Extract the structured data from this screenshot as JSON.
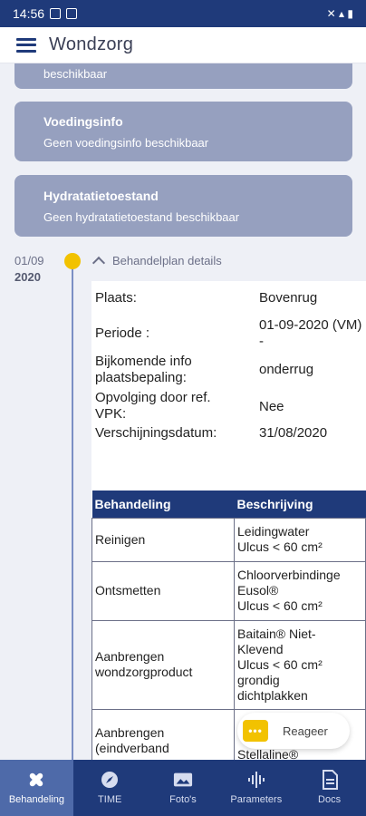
{
  "status": {
    "time": "14:56",
    "right_icons": "✕ ▴ ▮"
  },
  "app": {
    "title": "Wondzorg"
  },
  "cards": [
    {
      "title": "",
      "subtitle": "beschikbaar"
    },
    {
      "title": "Voedingsinfo",
      "subtitle": "Geen voedingsinfo beschikbaar"
    },
    {
      "title": "Hydratatietoestand",
      "subtitle": "Geen hydratatietoestand beschikbaar"
    }
  ],
  "timeline": {
    "date": "01/09",
    "year": "2020",
    "header": "Behandelplan details"
  },
  "details": [
    {
      "label": "Plaats:",
      "value": "Bovenrug"
    },
    {
      "label": "Periode :",
      "value": "01-09-2020 (VM) -"
    },
    {
      "label": "Bijkomende info plaatsbepaling:",
      "value": "onderrug"
    },
    {
      "label": "Opvolging door ref. VPK:",
      "value": "Nee"
    },
    {
      "label": "Verschijningsdatum:",
      "value": "31/08/2020"
    }
  ],
  "table": {
    "headers": [
      "Behandeling",
      "Beschrijving"
    ],
    "rows": [
      {
        "treatment": "Reinigen",
        "description": [
          "Leidingwater",
          "Ulcus < 60 cm²"
        ]
      },
      {
        "treatment": "Ontsmetten",
        "description": [
          "Chloorverbindinge",
          "Eusol®",
          "Ulcus < 60 cm²"
        ]
      },
      {
        "treatment": "Aanbrengen wondzorgproduct",
        "description": [
          "Baitain® Niet-",
          "Klevend",
          "Ulcus < 60 cm²",
          "grondig",
          "dichtplakken"
        ]
      },
      {
        "treatment": "Aanbrengen (eindverband",
        "description": [
          "Stellaline®"
        ]
      }
    ]
  },
  "react": {
    "label": "Reageer"
  },
  "nav": [
    {
      "label": "Behandeling",
      "icon": "bandage-icon",
      "active": true
    },
    {
      "label": "TIME",
      "icon": "compass-icon",
      "active": false
    },
    {
      "label": "Foto's",
      "icon": "photo-icon",
      "active": false
    },
    {
      "label": "Parameters",
      "icon": "waveform-icon",
      "active": false
    },
    {
      "label": "Docs",
      "icon": "document-icon",
      "active": false
    }
  ],
  "colors": {
    "primary": "#1f3a7a",
    "card": "#96a0bf",
    "accent": "#f2c200",
    "background": "#eef0f6"
  }
}
